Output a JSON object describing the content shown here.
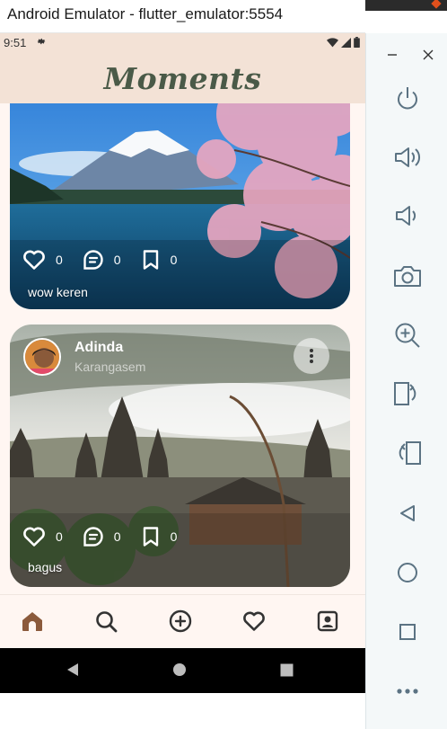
{
  "window": {
    "title": "Android Emulator - flutter_emulator:5554"
  },
  "status_bar": {
    "time": "9:51",
    "settings_icon": "gear-icon",
    "icons": [
      "wifi-icon",
      "signal-icon",
      "battery-icon"
    ]
  },
  "app": {
    "title": "Moments",
    "title_color": "#4a5a48",
    "header_bg": "#f3e2d6",
    "accent": "#8b5a3c"
  },
  "posts": [
    {
      "caption": "wow keren",
      "likes": "0",
      "comments": "0",
      "saves": "0",
      "image_icon": "cherry-blossom-mountain-photo"
    },
    {
      "user": "Adinda",
      "location": "Karangasem",
      "caption": "bagus",
      "likes": "0",
      "comments": "0",
      "saves": "0",
      "image_icon": "bali-temple-photo"
    }
  ],
  "bottom_nav": {
    "items": [
      {
        "name": "home",
        "icon": "home-icon",
        "active": true
      },
      {
        "name": "search",
        "icon": "search-icon",
        "active": false
      },
      {
        "name": "add",
        "icon": "plus-circle-icon",
        "active": false
      },
      {
        "name": "favorites",
        "icon": "heart-icon",
        "active": false
      },
      {
        "name": "profile",
        "icon": "profile-icon",
        "active": false
      }
    ]
  },
  "system_nav": [
    "back-icon",
    "home-circle-icon",
    "recents-icon"
  ],
  "emulator_toolbar": {
    "window_controls": [
      "minimize-icon",
      "close-icon"
    ],
    "tools": [
      "power-icon",
      "volume-up-icon",
      "volume-down-icon",
      "camera-icon",
      "zoom-in-icon",
      "rotate-left-icon",
      "rotate-right-icon",
      "back-triangle-icon",
      "home-circle-icon",
      "overview-square-icon",
      "more-icon"
    ]
  }
}
